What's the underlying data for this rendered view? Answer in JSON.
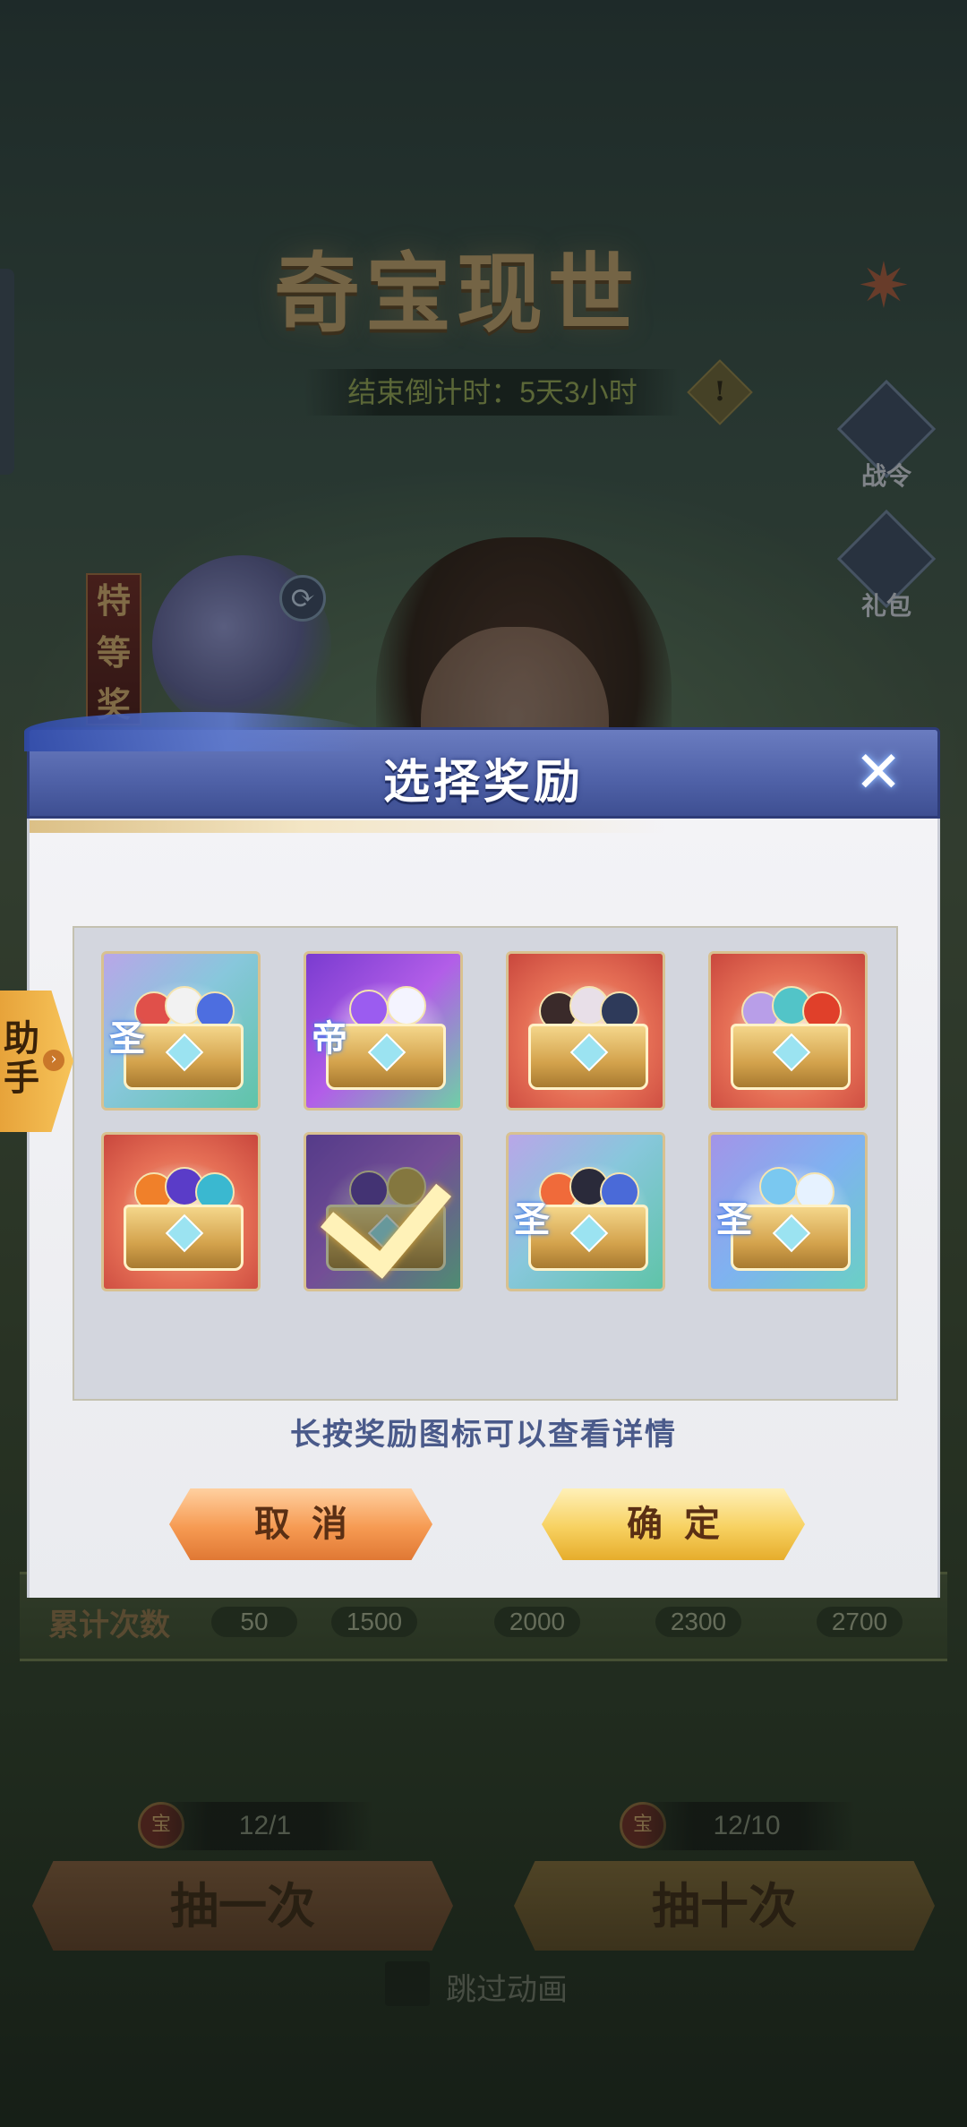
{
  "event": {
    "title": "奇宝现世",
    "countdown": "结束倒计时：5天3小时",
    "info_glyph": "!",
    "grand_prize_tag": "特等奖",
    "side_buttons": [
      {
        "label": "战令",
        "icon": "battle-pass-icon"
      },
      {
        "label": "礼包",
        "icon": "gift-pack-icon"
      }
    ]
  },
  "progress": {
    "label": "累计次数",
    "milestones": [
      "50",
      "1500",
      "2000",
      "2300",
      "2700"
    ]
  },
  "draw": {
    "one": {
      "count": "12/1",
      "label": "抽一次",
      "coin_glyph": "宝"
    },
    "ten": {
      "count": "12/10",
      "label": "抽十次",
      "coin_glyph": "宝"
    },
    "skip_label": "跳过动画"
  },
  "assistant": {
    "label": "助手",
    "arrow": "›"
  },
  "modal": {
    "title": "选择奖励",
    "close_glyph": "✕",
    "hint": "长按奖励图标可以查看详情",
    "cancel_label": "取消",
    "confirm_label": "确定",
    "rewards": [
      {
        "theme": "teal",
        "rune": "圣",
        "selected": false
      },
      {
        "theme": "purple",
        "rune": "帝",
        "selected": false
      },
      {
        "theme": "red",
        "rune": "",
        "selected": false
      },
      {
        "theme": "red",
        "rune": "",
        "selected": false
      },
      {
        "theme": "red",
        "rune": "",
        "selected": false
      },
      {
        "theme": "purple",
        "rune": "",
        "selected": true
      },
      {
        "theme": "teal",
        "rune": "圣",
        "selected": false
      },
      {
        "theme": "blue",
        "rune": "圣",
        "selected": false
      }
    ]
  },
  "colors": {
    "header_blue": "#4f61a7",
    "cancel_orange": "#f69a52",
    "confirm_gold": "#f7d160",
    "hint_text": "#4a5a8a"
  }
}
